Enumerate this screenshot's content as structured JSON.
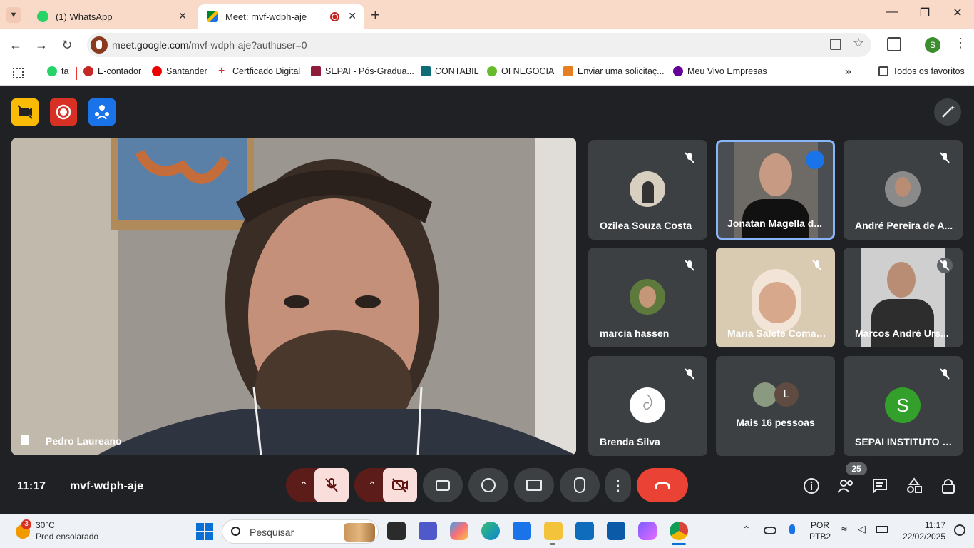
{
  "browser": {
    "tabs": [
      {
        "title": "(1) WhatsApp",
        "active": false
      },
      {
        "title": "Meet: mvf-wdph-aje",
        "active": true
      }
    ],
    "url_host": "meet.google.com",
    "url_path": "/mvf-wdph-aje?authuser=0",
    "profile_initial": "S",
    "bookmarks": [
      "ta",
      "E-contador",
      "Santander",
      "Certficado Digital",
      "SEPAI - Pós-Gradua...",
      "CONTABIL",
      "OI NEGOCIA",
      "Enviar uma solicitaç...",
      "Meu Vivo Empresas"
    ],
    "all_bookmarks_label": "Todos os favoritos"
  },
  "meet": {
    "main_speaker": "Pedro Laureano",
    "participants": [
      {
        "name": "Ozilea Souza Costa",
        "muted": true
      },
      {
        "name": "Jonatan Magella d...",
        "muted": false,
        "speaking": true
      },
      {
        "name": "André Pereira de A...",
        "muted": true
      },
      {
        "name": "marcia hassen",
        "muted": true
      },
      {
        "name": "Maria Salete Comar...",
        "muted": true
      },
      {
        "name": "Marcos André Urs...",
        "muted": true
      },
      {
        "name": "Brenda Silva",
        "muted": true
      },
      {
        "name": "Mais 16 pessoas",
        "extra_avatar_letter": "L"
      },
      {
        "name": "SEPAI INSTITUTO S...",
        "muted": true,
        "avatar_letter": "S"
      }
    ],
    "time": "11:17",
    "meeting_code": "mvf-wdph-aje",
    "participant_count": "25",
    "colors": {
      "end_call": "#ea4335",
      "accent_blue": "#8ab4f8",
      "muted_red": "#f9dedc"
    }
  },
  "taskbar": {
    "weather_badge": "3",
    "temperature": "30°C",
    "weather_text": "Pred ensolarado",
    "search_placeholder": "Pesquisar",
    "lang_top": "POR",
    "lang_bottom": "PTB2",
    "clock_time": "11:17",
    "clock_date": "22/02/2025"
  }
}
